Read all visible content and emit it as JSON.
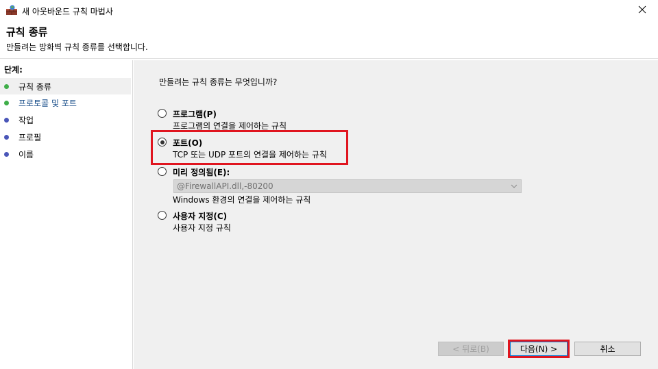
{
  "window": {
    "title": "새 아웃바운드 규칙 마법사",
    "close_glyph": "✕"
  },
  "header": {
    "title": "규칙 종류",
    "description": "만들려는 방화벽 규칙 종류를 선택합니다."
  },
  "sidebar": {
    "steps_label": "단계:",
    "steps": [
      {
        "label": "규칙 종류",
        "state": "current",
        "dot_color": "#3fae49"
      },
      {
        "label": "프로토콜 및 포트",
        "state": "next",
        "dot_color": "#3fae49",
        "text_color": "#1a4f8a"
      },
      {
        "label": "작업",
        "state": "pending",
        "dot_color": "#4a56b8"
      },
      {
        "label": "프로필",
        "state": "pending",
        "dot_color": "#4a56b8"
      },
      {
        "label": "이름",
        "state": "pending",
        "dot_color": "#4a56b8"
      }
    ]
  },
  "main": {
    "question": "만들려는 규칙 종류는 무엇입니까?",
    "options": [
      {
        "label": "프로그램(P)",
        "description": "프로그램의 연결을 제어하는 규칙",
        "checked": false
      },
      {
        "label": "포트(O)",
        "description": "TCP 또는 UDP 포트의 연결을 제어하는 규칙",
        "checked": true
      },
      {
        "label": "미리 정의됨(E):",
        "description": "Windows 환경의 연결을 제어하는 규칙",
        "checked": false
      },
      {
        "label": "사용자 지정(C)",
        "description": "사용자 지정 규칙",
        "checked": false
      }
    ],
    "predefined_combo": {
      "value": "@FirewallAPI.dll,-80200",
      "disabled": true
    }
  },
  "buttons": {
    "back": "< 뒤로(B)",
    "next": "다음(N) >",
    "cancel": "취소"
  },
  "colors": {
    "highlight": "#e0151f",
    "content_bg": "#f0f0f0"
  }
}
